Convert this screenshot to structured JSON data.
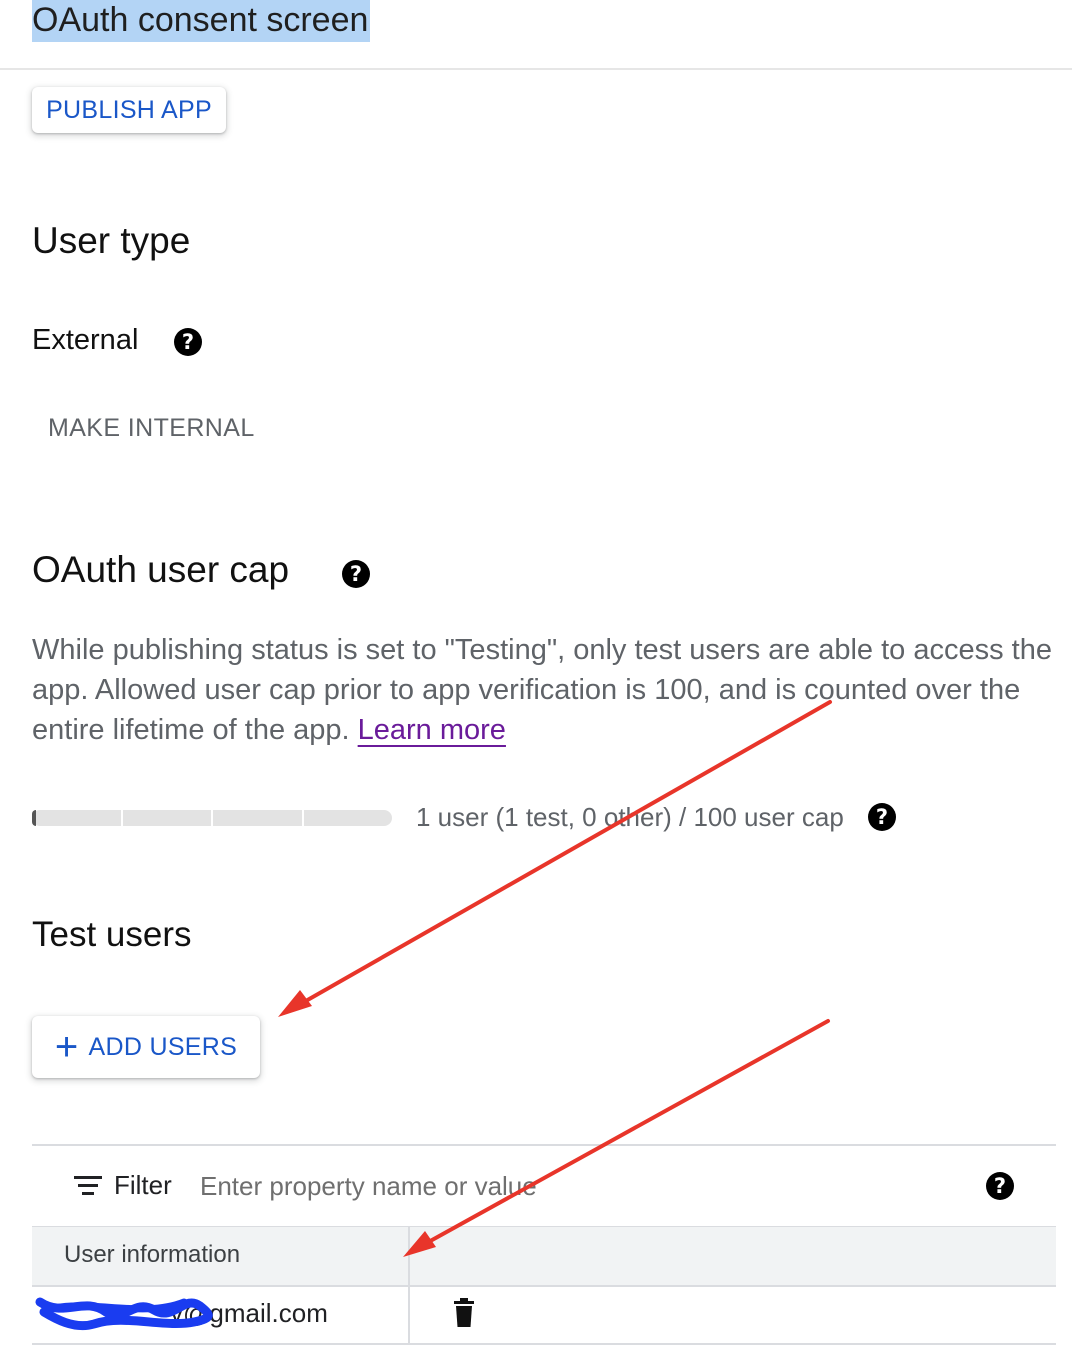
{
  "header": {
    "title": "OAuth consent screen"
  },
  "actions": {
    "publish_label": "PUBLISH APP"
  },
  "user_type": {
    "heading": "User type",
    "value": "External",
    "make_internal_label": "MAKE INTERNAL"
  },
  "user_cap": {
    "heading": "OAuth user cap",
    "description": "While publishing status is set to \"Testing\", only test users are able to access the app. Allowed user cap prior to app verification is 100, and is counted over the entire lifetime of the app. ",
    "learn_more": "Learn more",
    "progress_fraction": 0.01,
    "summary": "1 user (1 test, 0 other) / 100 user cap"
  },
  "test_users": {
    "heading": "Test users",
    "add_users_label": "ADD USERS",
    "filter_label": "Filter",
    "filter_placeholder": "Enter property name or value",
    "column_header": "User information",
    "rows": [
      {
        "email_visible": "y@gmail.com"
      }
    ]
  },
  "icons": {
    "help": "help-circle-icon",
    "filter": "filter-lines-icon",
    "add": "plus-icon",
    "delete": "trash-icon"
  },
  "colors": {
    "accent": "#1a57c8",
    "link_visited": "#6a1b9a",
    "annotation_arrow": "#e8352a",
    "redaction": "#1a3cf0"
  }
}
